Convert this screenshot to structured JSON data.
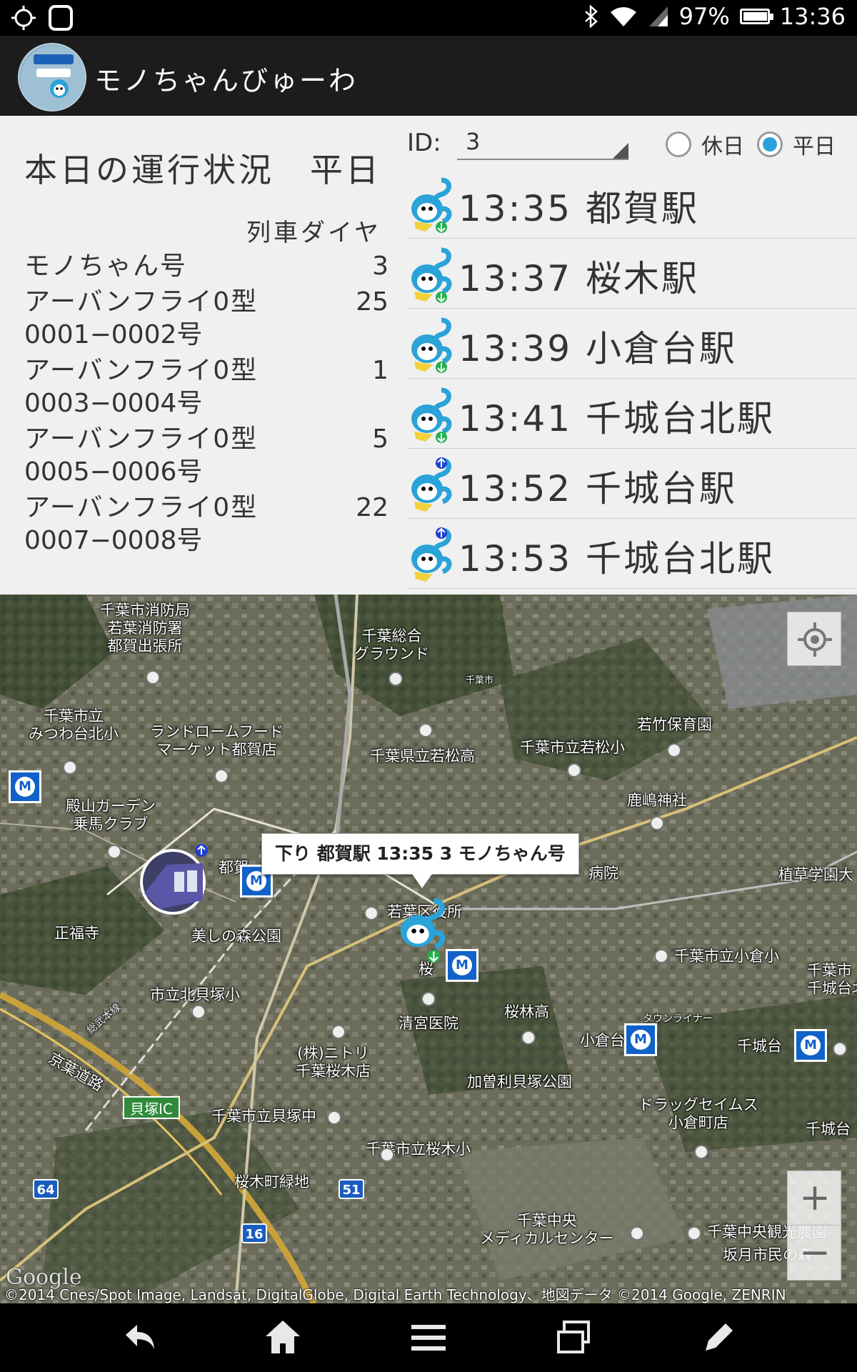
{
  "status_bar": {
    "battery": "97%",
    "battery_level": 0.97,
    "time": "13:36",
    "icons": [
      "gps-icon",
      "notification-icon",
      "bluetooth-icon",
      "wifi-icon",
      "signal-icon",
      "battery-icon"
    ]
  },
  "app": {
    "title": "モノちゃんびゅーわ"
  },
  "operation": {
    "title": "本日の運行状況　平日",
    "dia_header": "列車ダイヤ",
    "trains": [
      {
        "name": "モノちゃん号",
        "sub": "",
        "dia": "3"
      },
      {
        "name": "アーバンフライ0型",
        "sub": "0001−0002号",
        "dia": "25"
      },
      {
        "name": "アーバンフライ0型",
        "sub": "0003−0004号",
        "dia": "1"
      },
      {
        "name": "アーバンフライ0型",
        "sub": "0005−0006号",
        "dia": "5"
      },
      {
        "name": "アーバンフライ0型",
        "sub": "0007−0008号",
        "dia": "22"
      }
    ]
  },
  "filter": {
    "id_label": "ID:",
    "id_value": "3",
    "holiday_label": "休日",
    "weekday_label": "平日",
    "selected": "weekday"
  },
  "schedule": [
    {
      "time_station": "13:35 都賀駅",
      "direction": "down"
    },
    {
      "time_station": "13:37 桜木駅",
      "direction": "down"
    },
    {
      "time_station": "13:39 小倉台駅",
      "direction": "down"
    },
    {
      "time_station": "13:41 千城台北駅",
      "direction": "down"
    },
    {
      "time_station": "13:52 千城台駅",
      "direction": "up"
    },
    {
      "time_station": "13:53 千城台北駅",
      "direction": "up"
    }
  ],
  "map": {
    "popup": "下り 都賀駅 13:35 3 モノちゃん号",
    "labels": {
      "fire_station": "千葉市消防局\n若葉消防署\n都賀出張所",
      "sports_ground": "千葉総合\nグラウンド",
      "mitsuwa_school": "千葉市立\nみつわ台北小",
      "landrome": "ランドロームフード\nマーケット都賀店",
      "chiba_city": "千葉市",
      "wakamatsu_high": "千葉県立若松高",
      "wakamatsu_elem": "千葉市立若松小",
      "wakatake": "若竹保育園",
      "kashima": "鹿嶋神社",
      "tonoyama": "殿山ガーデン\n乗馬クラブ",
      "tsuga_st": "都賀",
      "hospital_right": "病院",
      "shokuei": "植草学園大",
      "shofukuji": "正福寺",
      "utsukushinomori": "美しの森公園",
      "wakaba_ward": "若葉区役所",
      "ogura_elem": "千葉市立小倉小",
      "chiba_city_right": "千葉市\n千城台北",
      "kitakaizuka": "市立北貝塚小",
      "sakuragi": "桜",
      "seimiya": "清宮医院",
      "sakurabayashi": "桜林高",
      "ogura_st": "小倉台",
      "town_liner": "タウンライナー",
      "chishirodai_st": "千城台",
      "nitori": "(株)ニトリ\n千葉桜木店",
      "kasori": "加曽利貝塚公園",
      "keiyo": "京葉道路",
      "kaizuka_ic": "貝塚IC",
      "kaizuka_mid": "千葉市立貝塚中",
      "drugstore": "ドラッグセイムス\n小倉町店",
      "chishirodai_right": "千城台",
      "sakuragi_elem": "千葉市立桜木小",
      "sakuragicho": "桜木町緑地",
      "route_64": "64",
      "route_51": "51",
      "route_16": "16",
      "medical_center": "千葉中央\nメディカルセンター",
      "kankou_farm": "千葉中央観光農園",
      "sakatsuki": "坂月市民の森",
      "sobu": "総武本線"
    },
    "google": "Google",
    "copyright": "©2014 Cnes/Spot Image, Landsat, DigitalGlobe, Digital Earth Technology、地図データ ©2014 Google, ZENRIN",
    "zoom_in": "+",
    "zoom_out": "−"
  },
  "nav": {
    "buttons": [
      "back-icon",
      "home-icon",
      "menu-icon",
      "recent-apps-icon",
      "edit-icon"
    ]
  },
  "colors": {
    "accent": "#2aa3d8",
    "monorail_blue": "#1062c8",
    "down_marker": "#22b14c",
    "up_marker": "#1f3fd1"
  }
}
